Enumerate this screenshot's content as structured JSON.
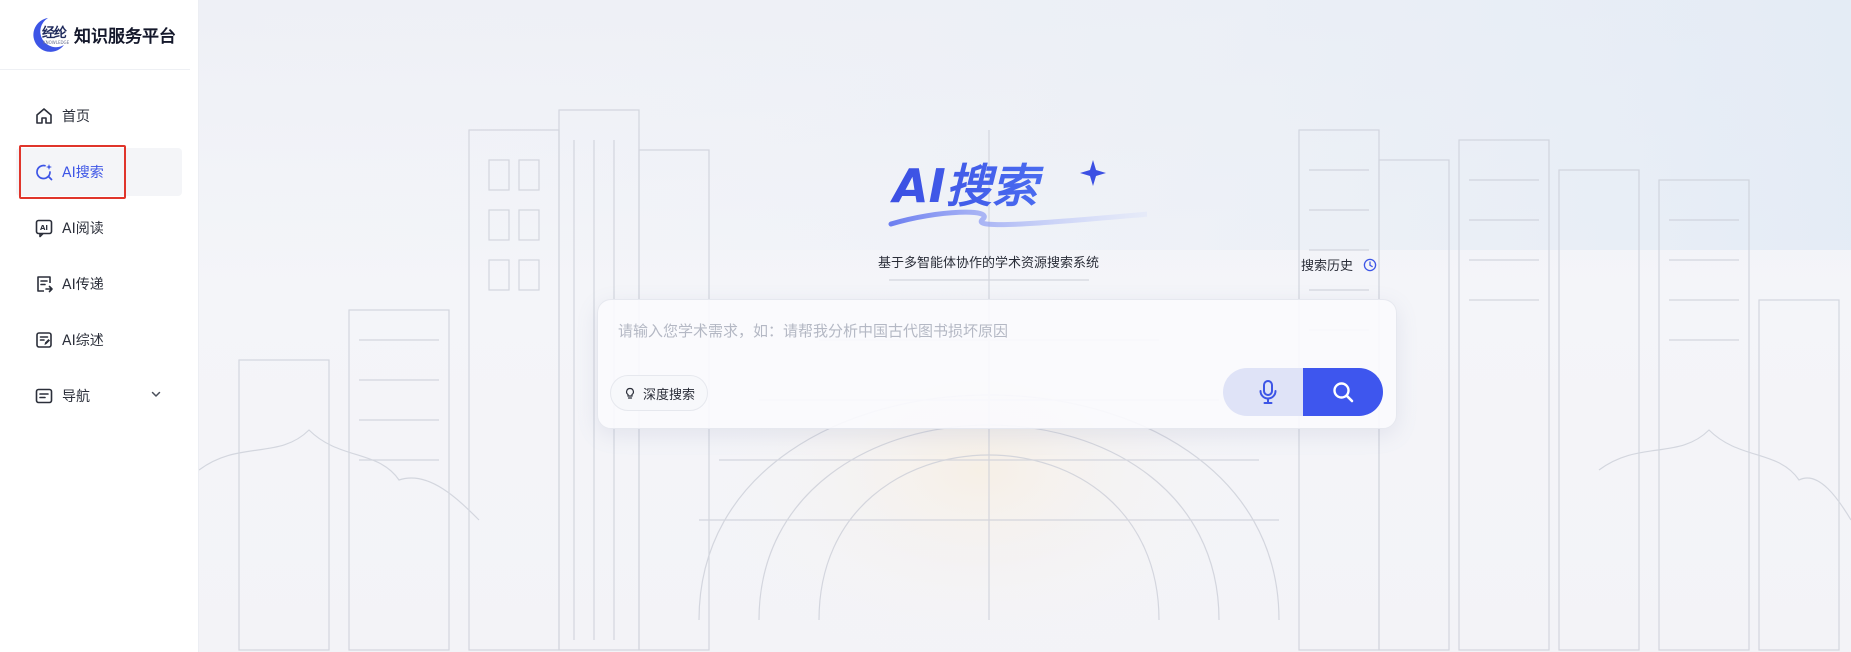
{
  "brand": {
    "logo_cn": "经纶",
    "logo_en": "KNOWLEDGE",
    "name": "知识服务平台"
  },
  "sidebar": {
    "items": [
      {
        "label": "首页",
        "icon": "home-icon"
      },
      {
        "label": "AI搜索",
        "icon": "ai-search-icon",
        "active": true
      },
      {
        "label": "AI阅读",
        "icon": "ai-read-icon"
      },
      {
        "label": "AI传递",
        "icon": "ai-deliver-icon"
      },
      {
        "label": "AI综述",
        "icon": "ai-review-icon"
      },
      {
        "label": "导航",
        "icon": "nav-icon",
        "has_children": true
      }
    ]
  },
  "hero": {
    "title": "AI搜索",
    "subtitle": "基于多智能体协作的学术资源搜索系统"
  },
  "history": {
    "label": "搜索历史"
  },
  "search": {
    "placeholder": "请输入您学术需求，如：请帮我分析中国古代图书损坏原因",
    "value": "",
    "deep_label": "深度搜索"
  },
  "colors": {
    "accent": "#3e56ee",
    "accent_light": "#dfe3f7",
    "highlight": "#e0352b",
    "text": "#2a2d38"
  }
}
